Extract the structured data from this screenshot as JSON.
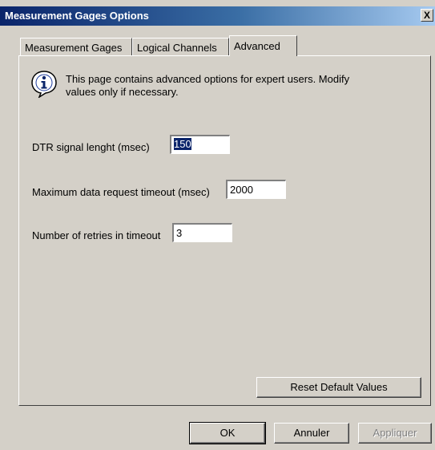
{
  "window": {
    "title": "Measurement Gages Options",
    "close_glyph": "X"
  },
  "tabs": [
    {
      "label": "Measurement Gages",
      "active": false
    },
    {
      "label": "Logical Channels",
      "active": false
    },
    {
      "label": "Advanced",
      "active": true
    }
  ],
  "info": {
    "icon": "info-icon",
    "text": "This page contains advanced options for expert users. Modify values only if necessary."
  },
  "fields": {
    "dtr": {
      "label": "DTR signal lenght (msec)",
      "value": "150"
    },
    "timeout": {
      "label": "Maximum data request timeout (msec)",
      "value": "2000"
    },
    "retries": {
      "label": "Number of retries in timeout",
      "value": "3"
    }
  },
  "buttons": {
    "reset": "Reset Default Values",
    "ok": "OK",
    "cancel": "Annuler",
    "apply": "Appliquer"
  },
  "colors": {
    "titlebar_start": "#0a246a",
    "titlebar_end": "#a6caf0",
    "face": "#d4d0c8",
    "selection": "#0a246a"
  }
}
